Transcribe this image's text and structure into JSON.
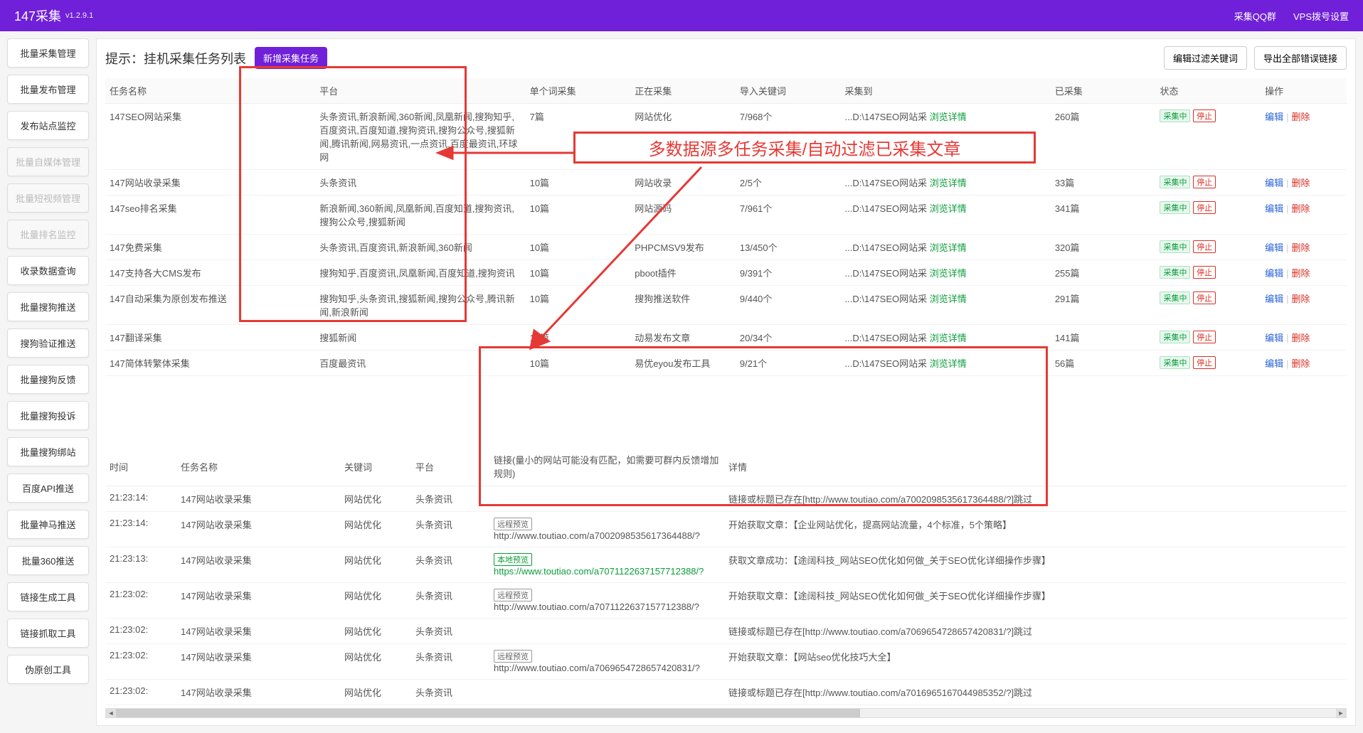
{
  "header": {
    "title": "147采集",
    "version": "v1.2.9.1",
    "links": [
      "采集QQ群",
      "VPS拨号设置"
    ]
  },
  "sidebar": [
    {
      "label": "批量采集管理",
      "disabled": false
    },
    {
      "label": "批量发布管理",
      "disabled": false
    },
    {
      "label": "发布站点监控",
      "disabled": false
    },
    {
      "label": "批量自媒体管理",
      "disabled": true
    },
    {
      "label": "批量短视频管理",
      "disabled": true
    },
    {
      "label": "批量排名监控",
      "disabled": true
    },
    {
      "label": "收录数据查询",
      "disabled": false
    },
    {
      "label": "批量搜狗推送",
      "disabled": false
    },
    {
      "label": "搜狗验证推送",
      "disabled": false
    },
    {
      "label": "批量搜狗反馈",
      "disabled": false
    },
    {
      "label": "批量搜狗投诉",
      "disabled": false
    },
    {
      "label": "批量搜狗绑站",
      "disabled": false
    },
    {
      "label": "百度API推送",
      "disabled": false
    },
    {
      "label": "批量神马推送",
      "disabled": false
    },
    {
      "label": "批量360推送",
      "disabled": false
    },
    {
      "label": "链接生成工具",
      "disabled": false
    },
    {
      "label": "链接抓取工具",
      "disabled": false
    },
    {
      "label": "伪原创工具",
      "disabled": false
    }
  ],
  "titleRow": {
    "hint": "提示：挂机采集任务列表",
    "newTask": "新增采集任务",
    "editFilter": "编辑过滤关键词",
    "exportErr": "导出全部错误链接"
  },
  "tasks": {
    "headers": [
      "任务名称",
      "平台",
      "单个词采集",
      "正在采集",
      "导入关键词",
      "采集到",
      "已采集",
      "状态",
      "操作"
    ],
    "detailLabel": "浏览详情",
    "statusRunning": "采集中",
    "stop": "停止",
    "edit": "编辑",
    "del": "删除",
    "destPrefix": "...D:\\147SEO网站采",
    "rows": [
      {
        "name": "147SEO网站采集",
        "platform": "头条资讯,新浪新闻,360新闻,凤凰新闻,搜狗知乎,百度资讯,百度知道,搜狗资讯,搜狗公众号,搜狐新闻,腾讯新闻,网易资讯,一点资讯,百度最资讯,环球网",
        "single": "7篇",
        "collecting": "网站优化",
        "imported": "7/968个",
        "collected": "260篇"
      },
      {
        "name": "147网站收录采集",
        "platform": "头条资讯",
        "single": "10篇",
        "collecting": "网站收录",
        "imported": "2/5个",
        "collected": "33篇"
      },
      {
        "name": "147seo排名采集",
        "platform": "新浪新闻,360新闻,凤凰新闻,百度知道,搜狗资讯,搜狗公众号,搜狐新闻",
        "single": "10篇",
        "collecting": "网站源码",
        "imported": "7/961个",
        "collected": "341篇"
      },
      {
        "name": "147免费采集",
        "platform": "头条资讯,百度资讯,新浪新闻,360新闻",
        "single": "10篇",
        "collecting": "PHPCMSV9发布",
        "imported": "13/450个",
        "collected": "320篇"
      },
      {
        "name": "147支持各大CMS发布",
        "platform": "搜狗知乎,百度资讯,凤凰新闻,百度知道,搜狗资讯",
        "single": "10篇",
        "collecting": "pboot插件",
        "imported": "9/391个",
        "collected": "255篇"
      },
      {
        "name": "147自动采集为原创发布推送",
        "platform": "搜狗知乎,头条资讯,搜狐新闻,搜狗公众号,腾讯新闻,新浪新闻",
        "single": "10篇",
        "collecting": "搜狗推送软件",
        "imported": "9/440个",
        "collected": "291篇"
      },
      {
        "name": "147翻译采集",
        "platform": "搜狐新闻",
        "single": "10篇",
        "collecting": "动易发布文章",
        "imported": "20/34个",
        "collected": "141篇"
      },
      {
        "name": "147简体转繁体采集",
        "platform": "百度最资讯",
        "single": "10篇",
        "collecting": "易优eyou发布工具",
        "imported": "9/21个",
        "collected": "56篇"
      }
    ]
  },
  "log": {
    "headers": [
      "时间",
      "任务名称",
      "关键词",
      "平台",
      "链接(量小的网站可能没有匹配，如需要可群内反馈增加规则)",
      "详情"
    ],
    "remote": "远程预览",
    "local": "本地预览",
    "rows": [
      {
        "time": "21:23:14:",
        "task": "147网站收录采集",
        "kw": "网站优化",
        "plat": "头条资讯",
        "linkBadge": "",
        "link": "",
        "detail": "链接或标题已存在[http://www.toutiao.com/a7002098535617364488/?]跳过"
      },
      {
        "time": "21:23:14:",
        "task": "147网站收录采集",
        "kw": "网站优化",
        "plat": "头条资讯",
        "linkBadge": "remote",
        "link": "http://www.toutiao.com/a7002098535617364488/?",
        "detail": "开始获取文章：【企业网站优化，提高网站流量，4个标准，5个策略】"
      },
      {
        "time": "21:23:13:",
        "task": "147网站收录采集",
        "kw": "网站优化",
        "plat": "头条资讯",
        "linkBadge": "local",
        "link": "https://www.toutiao.com/a7071122637157712388/?",
        "detail": "获取文章成功：【途阔科技_网站SEO优化如何做_关于SEO优化详细操作步骤】"
      },
      {
        "time": "21:23:02:",
        "task": "147网站收录采集",
        "kw": "网站优化",
        "plat": "头条资讯",
        "linkBadge": "remote",
        "link": "http://www.toutiao.com/a7071122637157712388/?",
        "detail": "开始获取文章：【途阔科技_网站SEO优化如何做_关于SEO优化详细操作步骤】"
      },
      {
        "time": "21:23:02:",
        "task": "147网站收录采集",
        "kw": "网站优化",
        "plat": "头条资讯",
        "linkBadge": "",
        "link": "",
        "detail": "链接或标题已存在[http://www.toutiao.com/a7069654728657420831/?]跳过"
      },
      {
        "time": "21:23:02:",
        "task": "147网站收录采集",
        "kw": "网站优化",
        "plat": "头条资讯",
        "linkBadge": "remote",
        "link": "http://www.toutiao.com/a7069654728657420831/?",
        "detail": "开始获取文章：【网站seo优化技巧大全】"
      },
      {
        "time": "21:23:02:",
        "task": "147网站收录采集",
        "kw": "网站优化",
        "plat": "头条资讯",
        "linkBadge": "",
        "link": "",
        "detail": "链接或标题已存在[http://www.toutiao.com/a7016965167044985352/?]跳过"
      }
    ]
  },
  "annotation": "多数据源多任务采集/自动过滤已采集文章"
}
